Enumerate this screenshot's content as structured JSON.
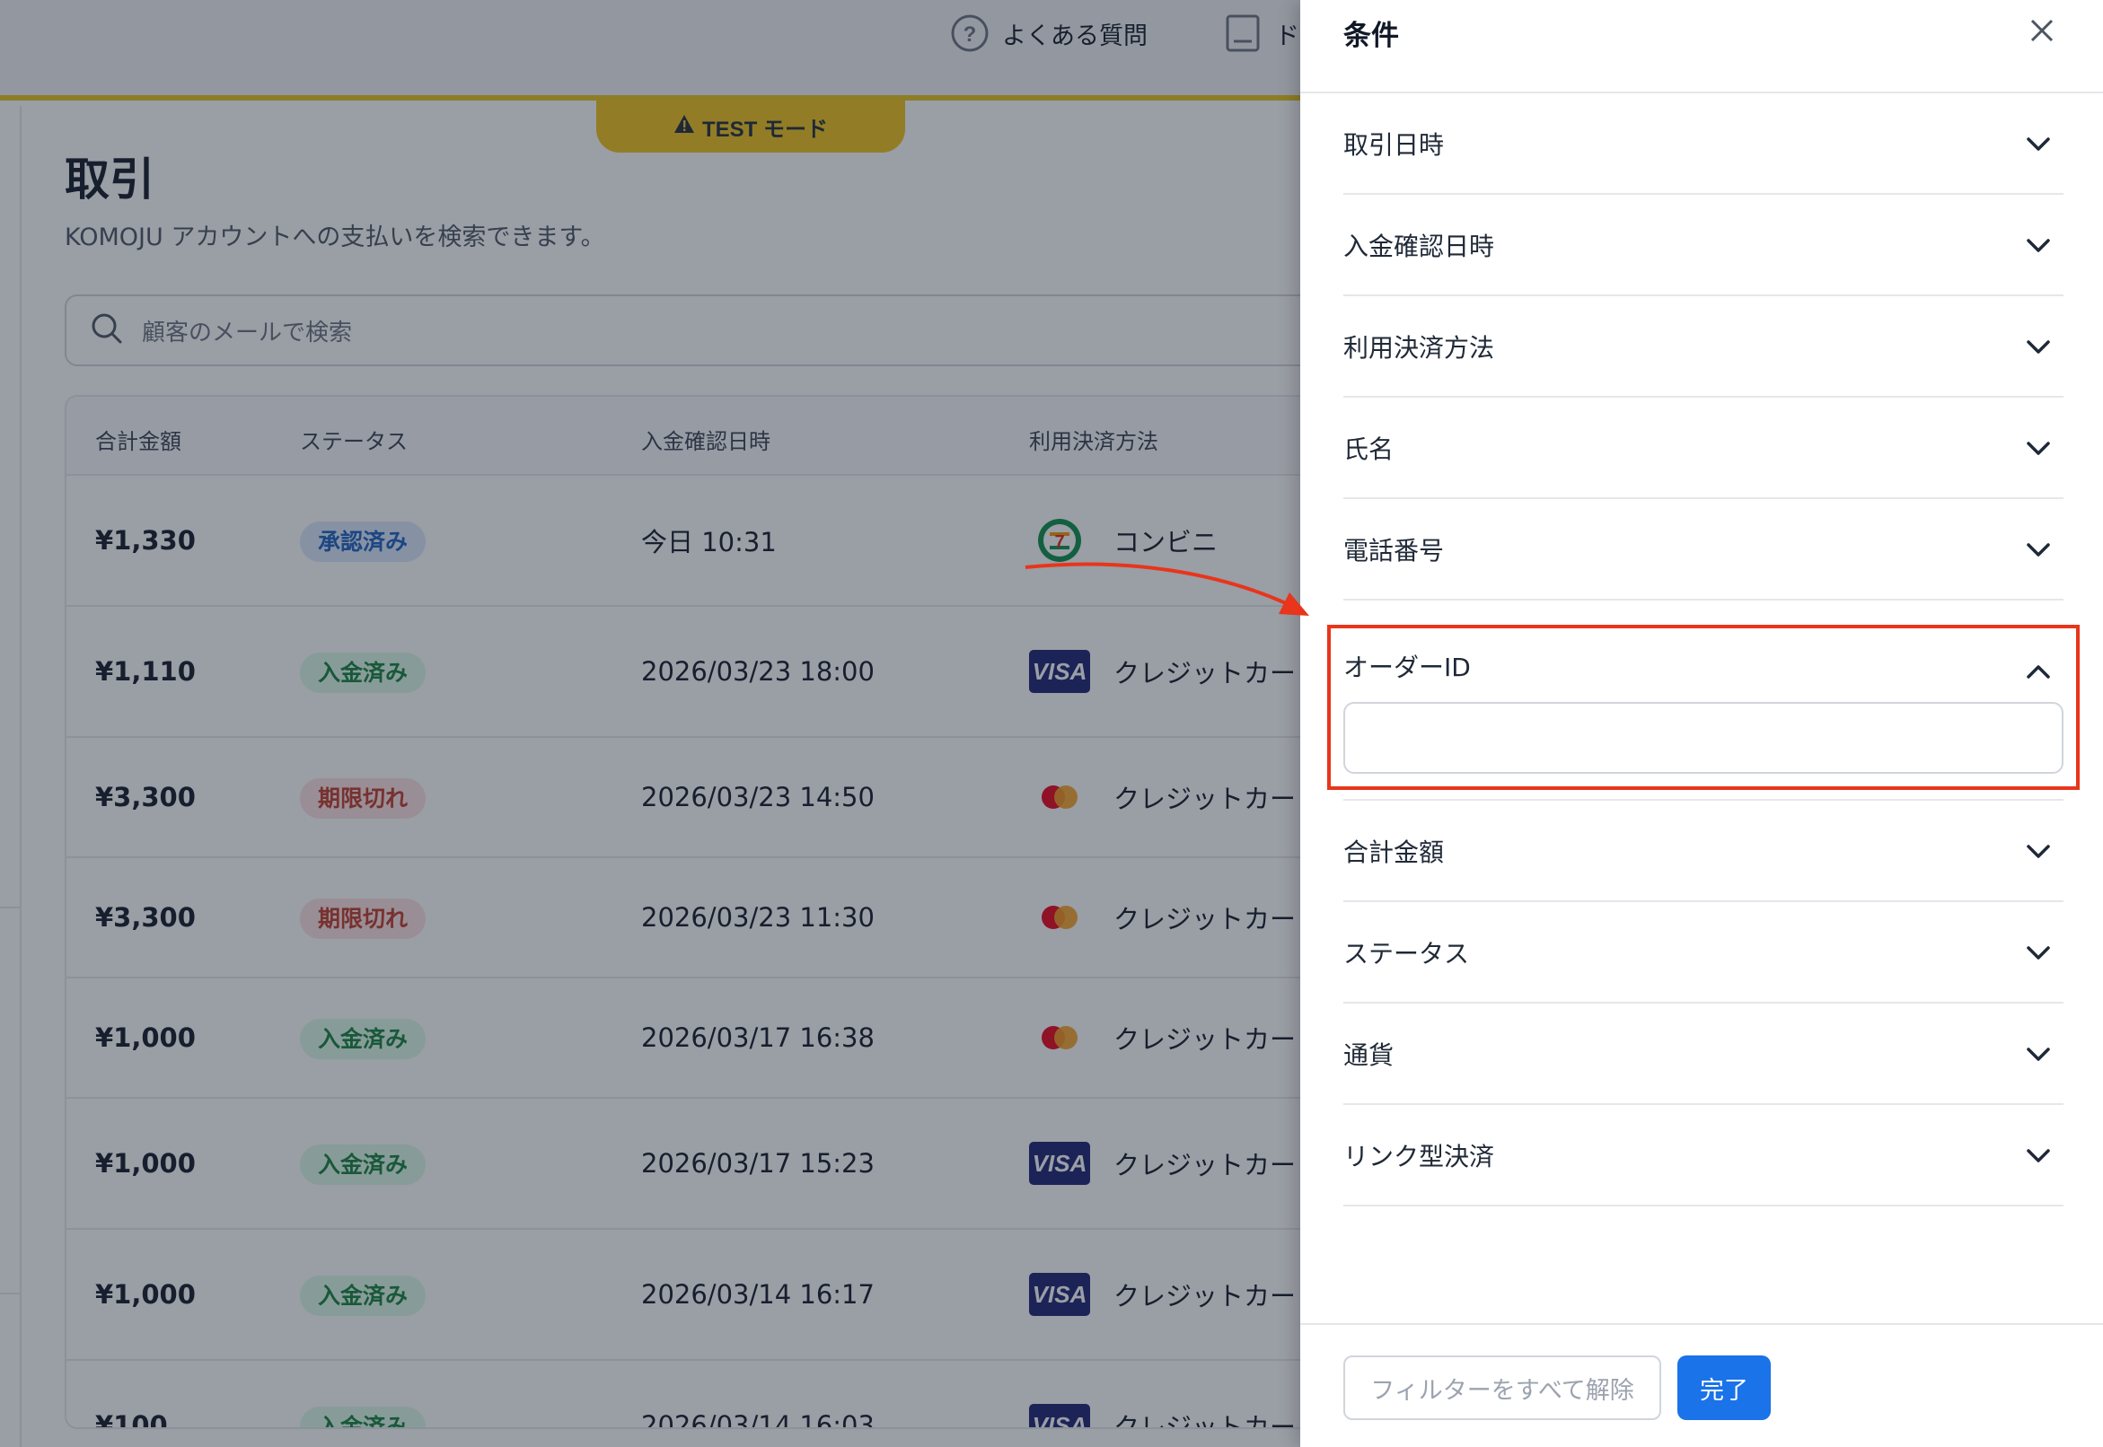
{
  "topnav": {
    "faq_label": "よくある質問",
    "docs_label": "ド"
  },
  "test_mode": {
    "label": "TEST モード",
    "icon": "warning-icon",
    "color": "#f0c419"
  },
  "page": {
    "title": "取引",
    "subtitle": "KOMOJU アカウントへの支払いを検索できます。"
  },
  "search": {
    "placeholder": "顧客のメールで検索"
  },
  "table": {
    "columns": [
      "合計金額",
      "ステータス",
      "入金確認日時",
      "利用決済方法"
    ],
    "rows": [
      {
        "amount": "¥1,330",
        "status": "承認済み",
        "status_color": "blue",
        "date": "今日 10:31",
        "method_icon": "seven-eleven-icon",
        "method": "コンビニ"
      },
      {
        "amount": "¥1,110",
        "status": "入金済み",
        "status_color": "green",
        "date": "2026/03/23 18:00",
        "method_icon": "visa-icon",
        "method": "クレジットカード"
      },
      {
        "amount": "¥3,300",
        "status": "期限切れ",
        "status_color": "red",
        "date": "2026/03/23 14:50",
        "method_icon": "mastercard-icon",
        "method": "クレジットカード"
      },
      {
        "amount": "¥3,300",
        "status": "期限切れ",
        "status_color": "red",
        "date": "2026/03/23 11:30",
        "method_icon": "mastercard-icon",
        "method": "クレジットカード"
      },
      {
        "amount": "¥1,000",
        "status": "入金済み",
        "status_color": "green",
        "date": "2026/03/17 16:38",
        "method_icon": "mastercard-icon",
        "method": "クレジットカード"
      },
      {
        "amount": "¥1,000",
        "status": "入金済み",
        "status_color": "green",
        "date": "2026/03/17 15:23",
        "method_icon": "visa-icon",
        "method": "クレジットカード"
      },
      {
        "amount": "¥1,000",
        "status": "入金済み",
        "status_color": "green",
        "date": "2026/03/14 16:17",
        "method_icon": "visa-icon",
        "method": "クレジットカード"
      },
      {
        "amount": "¥100",
        "status": "入金済み",
        "status_color": "green",
        "date": "2026/03/14 16:03",
        "method_icon": "visa-icon",
        "method": "クレジットカード"
      }
    ]
  },
  "drawer": {
    "title": "条件",
    "filters": [
      "取引日時",
      "入金確認日時",
      "利用決済方法",
      "氏名",
      "電話番号"
    ],
    "open_filter": {
      "label": "オーダーID",
      "value": ""
    },
    "filters_after": [
      "合計金額",
      "ステータス",
      "通貨",
      "リンク型決済"
    ],
    "clear_label": "フィルターをすべて解除",
    "done_label": "完了"
  },
  "colors": {
    "accent": "#1a73e8",
    "highlight": "#e8351b",
    "test_bar": "#e8c319"
  }
}
